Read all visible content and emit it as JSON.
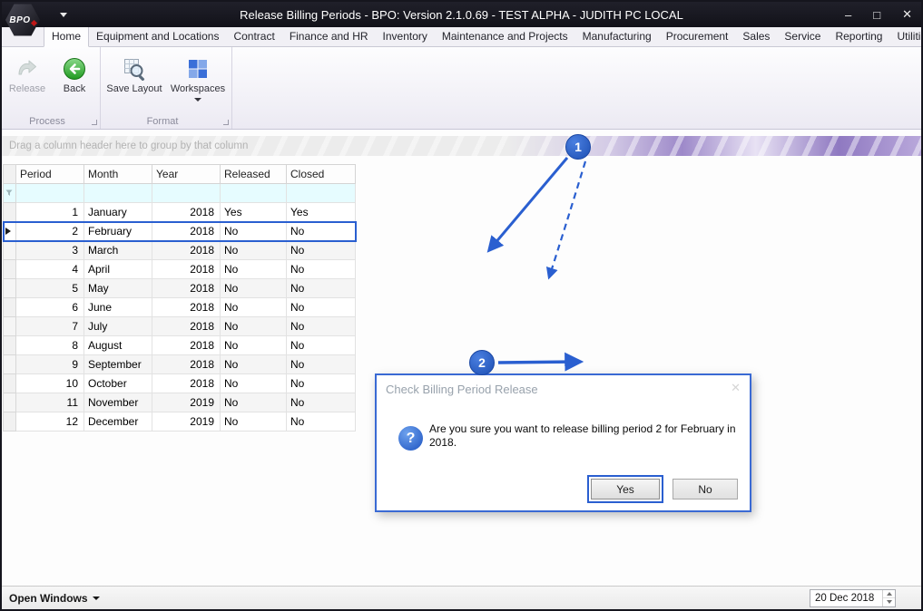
{
  "window": {
    "title": "Release Billing Periods - BPO: Version 2.1.0.69 - TEST ALPHA - JUDITH PC LOCAL",
    "logo_text": "BPO",
    "controls": {
      "minimize": "–",
      "maximize": "□",
      "close": "✕"
    }
  },
  "tabs": {
    "items": [
      "Home",
      "Equipment and Locations",
      "Contract",
      "Finance and HR",
      "Inventory",
      "Maintenance and Projects",
      "Manufacturing",
      "Procurement",
      "Sales",
      "Service",
      "Reporting",
      "Utilities"
    ],
    "active": "Home",
    "mdi_controls": {
      "minimize": "–",
      "close": "✕"
    }
  },
  "ribbon": {
    "groups": [
      {
        "label": "Process",
        "buttons": [
          {
            "label": "Release",
            "icon": "release-arrow-icon",
            "disabled": true
          },
          {
            "label": "Back",
            "icon": "back-arrow-icon",
            "disabled": false
          }
        ]
      },
      {
        "label": "Format",
        "buttons": [
          {
            "label": "Save Layout",
            "icon": "save-layout-icon",
            "disabled": false
          },
          {
            "label": "Workspaces",
            "icon": "workspaces-icon",
            "disabled": false,
            "has_dropdown": true
          }
        ]
      }
    ]
  },
  "grid": {
    "group_by_hint": "Drag a column header here to group by that column",
    "columns": [
      "Period",
      "Month",
      "Year",
      "Released",
      "Closed"
    ],
    "rows": [
      {
        "period": "1",
        "month": "January",
        "year": "2018",
        "released": "Yes",
        "closed": "Yes",
        "selected": false
      },
      {
        "period": "2",
        "month": "February",
        "year": "2018",
        "released": "No",
        "closed": "No",
        "selected": true
      },
      {
        "period": "3",
        "month": "March",
        "year": "2018",
        "released": "No",
        "closed": "No",
        "selected": false
      },
      {
        "period": "4",
        "month": "April",
        "year": "2018",
        "released": "No",
        "closed": "No",
        "selected": false
      },
      {
        "period": "5",
        "month": "May",
        "year": "2018",
        "released": "No",
        "closed": "No",
        "selected": false
      },
      {
        "period": "6",
        "month": "June",
        "year": "2018",
        "released": "No",
        "closed": "No",
        "selected": false
      },
      {
        "period": "7",
        "month": "July",
        "year": "2018",
        "released": "No",
        "closed": "No",
        "selected": false
      },
      {
        "period": "8",
        "month": "August",
        "year": "2018",
        "released": "No",
        "closed": "No",
        "selected": false
      },
      {
        "period": "9",
        "month": "September",
        "year": "2018",
        "released": "No",
        "closed": "No",
        "selected": false
      },
      {
        "period": "10",
        "month": "October",
        "year": "2018",
        "released": "No",
        "closed": "No",
        "selected": false
      },
      {
        "period": "11",
        "month": "November",
        "year": "2019",
        "released": "No",
        "closed": "No",
        "selected": false
      },
      {
        "period": "12",
        "month": "December",
        "year": "2019",
        "released": "No",
        "closed": "No",
        "selected": false
      }
    ]
  },
  "dialog": {
    "title": "Check Billing Period Release",
    "close_icon": "✕",
    "question_mark": "?",
    "message": "Are you sure you want to release billing period 2 for February in 2018.",
    "buttons": {
      "yes": "Yes",
      "no": "No"
    }
  },
  "statusbar": {
    "open_windows": "Open Windows",
    "date": "20 Dec 2018"
  },
  "annotations": {
    "step1": "1",
    "step2": "2",
    "accent_color": "#2a5fd0"
  }
}
